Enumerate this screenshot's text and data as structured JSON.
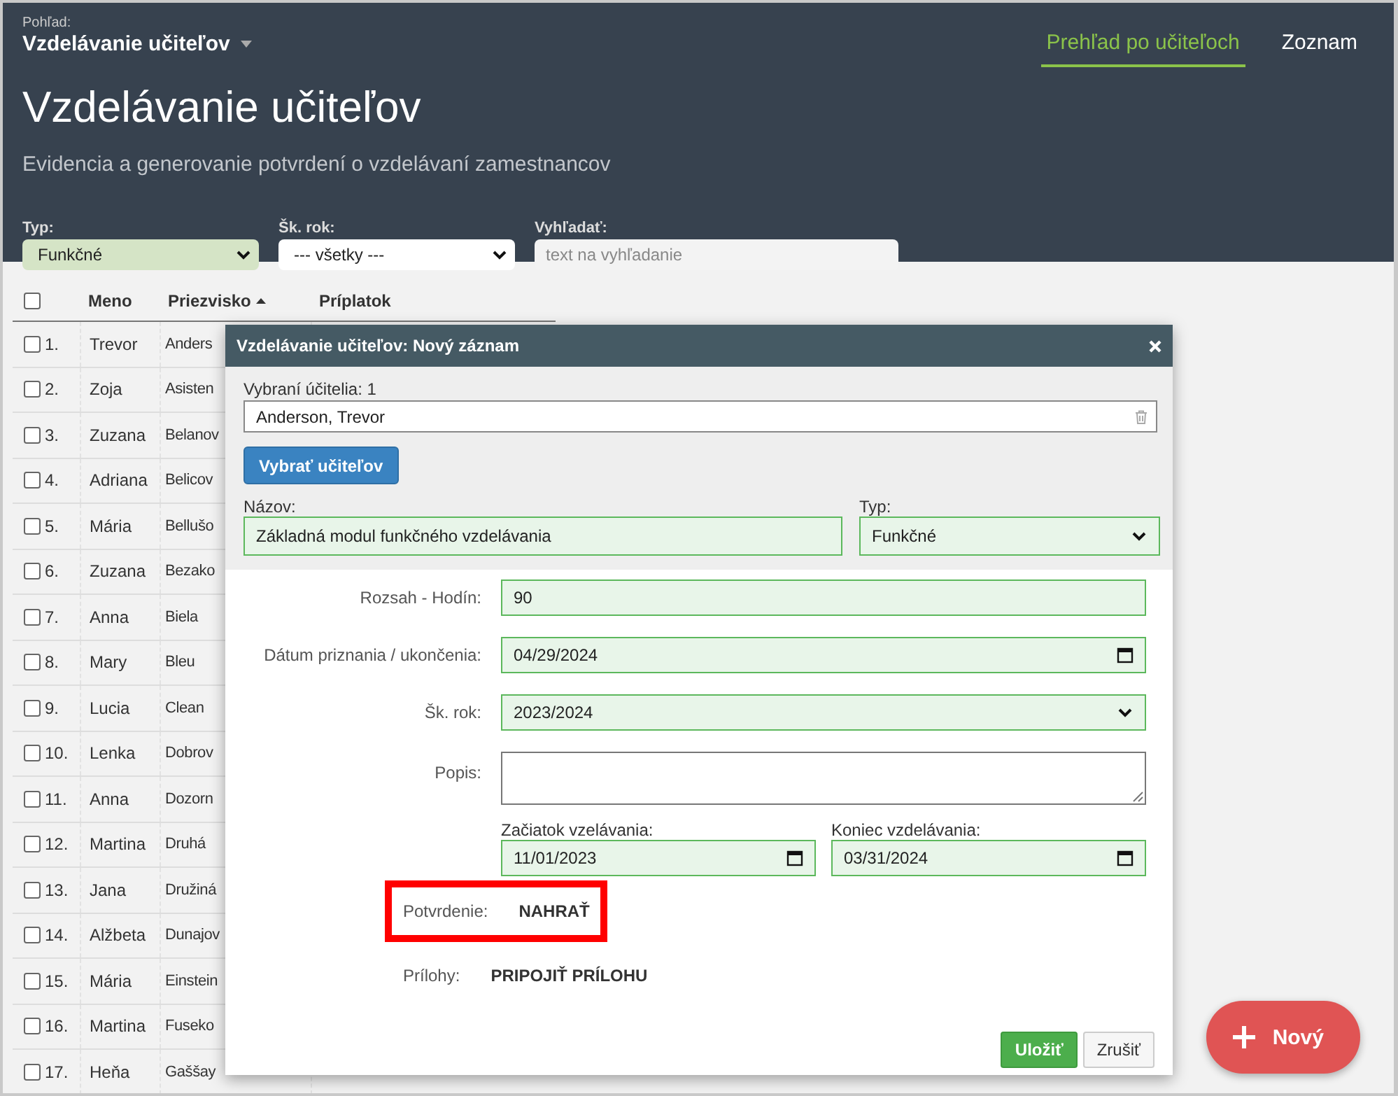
{
  "view": {
    "label": "Pohľad:",
    "value": "Vzdelávanie učiteľov"
  },
  "nav": [
    {
      "label": "Prehľad po učiteľoch",
      "selected": true
    },
    {
      "label": "Zoznam",
      "selected": false
    }
  ],
  "title": "Vzdelávanie učiteľov",
  "subtitle": "Evidencia a generovanie potvrdení o vzdelávaní zamestnancov",
  "filters": [
    {
      "kind": "select",
      "label": "Typ:",
      "value": "Funkčné",
      "active": true
    },
    {
      "kind": "select",
      "label": "Šk. rok:",
      "value": "--- všetky ---",
      "active": false
    },
    {
      "kind": "search",
      "label": "Vyhľadať:",
      "placeholder": "text na vyhľadanie"
    }
  ],
  "table": {
    "all_checked": false,
    "columns": [
      {
        "label": "Meno",
        "sorted": false
      },
      {
        "label": "Priezvisko",
        "sorted": true
      },
      {
        "label": "Príplatok",
        "sorted": false
      }
    ],
    "rows": [
      {
        "number": "1.",
        "first_name": "Trevor",
        "last_name": "Anders",
        "checked": false
      },
      {
        "number": "2.",
        "first_name": "Zoja",
        "last_name": "Asisten",
        "checked": false
      },
      {
        "number": "3.",
        "first_name": "Zuzana",
        "last_name": "Belanov",
        "checked": false
      },
      {
        "number": "4.",
        "first_name": "Adriana",
        "last_name": "Belicov",
        "checked": false
      },
      {
        "number": "5.",
        "first_name": "Mária",
        "last_name": "Bellušo",
        "checked": false
      },
      {
        "number": "6.",
        "first_name": "Zuzana",
        "last_name": "Bezako",
        "checked": false
      },
      {
        "number": "7.",
        "first_name": "Anna",
        "last_name": "Biela",
        "checked": false
      },
      {
        "number": "8.",
        "first_name": "Mary",
        "last_name": "Bleu",
        "checked": false
      },
      {
        "number": "9.",
        "first_name": "Lucia",
        "last_name": "Clean",
        "checked": false
      },
      {
        "number": "10.",
        "first_name": "Lenka",
        "last_name": "Dobrov",
        "checked": false
      },
      {
        "number": "11.",
        "first_name": "Anna",
        "last_name": "Dozorn",
        "checked": false
      },
      {
        "number": "12.",
        "first_name": "Martina",
        "last_name": "Druhá",
        "checked": false
      },
      {
        "number": "13.",
        "first_name": "Jana",
        "last_name": "Družiná",
        "checked": false
      },
      {
        "number": "14.",
        "first_name": "Alžbeta",
        "last_name": "Dunajov",
        "checked": false
      },
      {
        "number": "15.",
        "first_name": "Mária",
        "last_name": "Einstein",
        "checked": false
      },
      {
        "number": "16.",
        "first_name": "Martina",
        "last_name": "Fuseko",
        "checked": false
      },
      {
        "number": "17.",
        "first_name": "Heňa",
        "last_name": "Gaššay",
        "checked": false
      }
    ]
  },
  "dialog": {
    "title": "Vzdelávanie učiteľov: Nový záznam",
    "selected_label": "Vybraní účitelia: 1",
    "selected_teachers": [
      "Anderson, Trevor"
    ],
    "choose_button": "Vybrať učiteľov",
    "name": {
      "label": "Názov:",
      "value": "Základná modul funkčného vzdelávania"
    },
    "type": {
      "label": "Typ:",
      "value": "Funkčné"
    },
    "fields": [
      {
        "kind": "text",
        "label": "Rozsah - Hodín:",
        "value": "90"
      },
      {
        "kind": "date",
        "label": "Dátum priznania / ukončenia:",
        "value": "04/29/2024"
      },
      {
        "kind": "select",
        "label": "Šk. rok:",
        "value": "2023/2024"
      },
      {
        "kind": "textarea",
        "label": "Popis:"
      }
    ],
    "period": [
      {
        "label": "Začiatok vzelávania:",
        "value": "11/01/2023"
      },
      {
        "label": "Koniec vzdelávania:",
        "value": "03/31/2024"
      }
    ],
    "uploads": [
      {
        "label": "Potvrdenie:",
        "action": "NAHRAŤ",
        "highlighted": true
      },
      {
        "label": "Prílohy:",
        "action": "PRIPOJIŤ PRÍLOHU",
        "highlighted": false
      }
    ],
    "buttons": [
      {
        "kind": "primary",
        "label": "Uložiť"
      },
      {
        "kind": "default",
        "label": "Zrušiť"
      }
    ]
  },
  "fab": {
    "label": "Nový"
  }
}
